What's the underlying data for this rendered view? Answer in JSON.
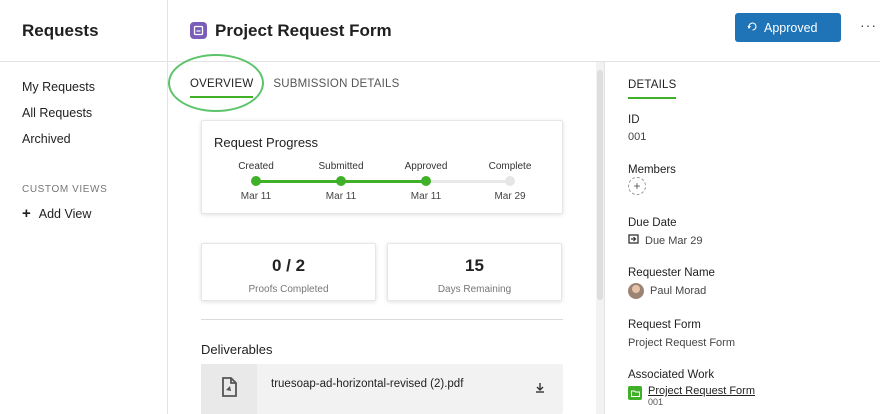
{
  "sidebar": {
    "title": "Requests",
    "items": [
      {
        "label": "My Requests"
      },
      {
        "label": "All Requests"
      },
      {
        "label": "Archived"
      }
    ],
    "section_label": "CUSTOM VIEWS",
    "add_view_label": "Add View"
  },
  "header": {
    "title": "Project Request Form",
    "status_button": "Approved",
    "more_label": "···"
  },
  "tabs": [
    {
      "label": "OVERVIEW",
      "active": true
    },
    {
      "label": "SUBMISSION DETAILS",
      "active": false
    }
  ],
  "progress": {
    "title": "Request Progress",
    "steps": [
      {
        "label": "Created",
        "date": "Mar 11",
        "done": true
      },
      {
        "label": "Submitted",
        "date": "Mar 11",
        "done": true
      },
      {
        "label": "Approved",
        "date": "Mar 11",
        "done": true
      },
      {
        "label": "Complete",
        "date": "Mar 29",
        "done": false
      }
    ]
  },
  "stats": {
    "proofs": {
      "value": "0 / 2",
      "label": "Proofs Completed"
    },
    "days": {
      "value": "15",
      "label": "Days Remaining"
    }
  },
  "deliverables": {
    "title": "Deliverables",
    "files": [
      {
        "name": "truesoap-ad-horizontal-revised (2).pdf"
      }
    ]
  },
  "details": {
    "heading": "DETAILS",
    "id_label": "ID",
    "id_value": "001",
    "members_label": "Members",
    "due_label": "Due Date",
    "due_value": "Due Mar 29",
    "requester_label": "Requester Name",
    "requester_value": "Paul Morad",
    "form_label": "Request Form",
    "form_value": "Project Request Form",
    "work_label": "Associated Work",
    "work_link": "Project Request Form",
    "work_id": "001"
  },
  "colors": {
    "accent_green": "#3fb028",
    "button_blue": "#1f73b7",
    "form_purple": "#7b5cb8"
  }
}
